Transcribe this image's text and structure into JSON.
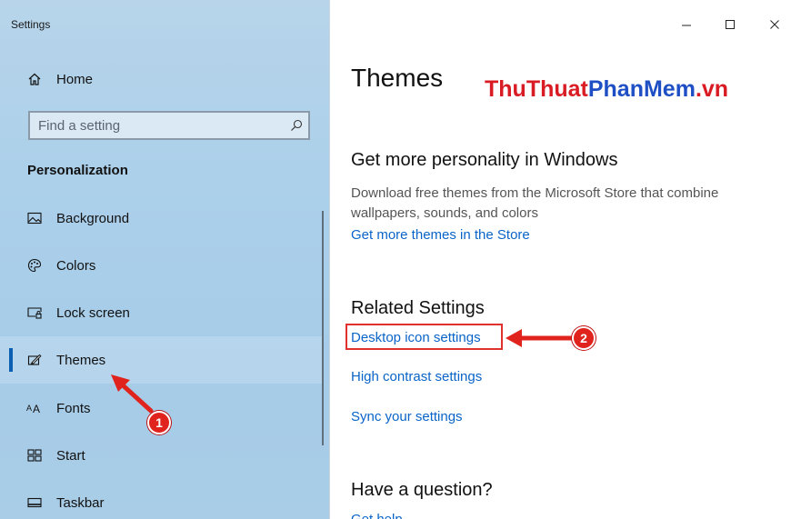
{
  "window": {
    "title": "Settings",
    "controls": {
      "minimize": "–",
      "maximize": "☐",
      "close": "✕"
    }
  },
  "sidebar": {
    "home_label": "Home",
    "search": {
      "placeholder": "Find a setting"
    },
    "section_header": "Personalization",
    "items": [
      {
        "label": "Background",
        "icon": "image-icon"
      },
      {
        "label": "Colors",
        "icon": "palette-icon"
      },
      {
        "label": "Lock screen",
        "icon": "lock-screen-icon"
      },
      {
        "label": "Themes",
        "icon": "brush-icon",
        "selected": true
      },
      {
        "label": "Fonts",
        "icon": "fonts-icon"
      },
      {
        "label": "Start",
        "icon": "start-icon"
      },
      {
        "label": "Taskbar",
        "icon": "taskbar-icon"
      }
    ]
  },
  "main": {
    "title": "Themes",
    "watermark": {
      "part1": "ThuThuat",
      "part2": "PhanMem",
      "part3": ".vn"
    },
    "personality": {
      "heading": "Get more personality in Windows",
      "description": "Download free themes from the Microsoft Store that combine wallpapers, sounds, and colors",
      "link": "Get more themes in the Store"
    },
    "related": {
      "heading": "Related Settings",
      "links": [
        "Desktop icon settings",
        "High contrast settings",
        "Sync your settings"
      ]
    },
    "question": {
      "heading": "Have a question?",
      "link": "Get help"
    }
  },
  "annotations": {
    "badge1": "1",
    "badge2": "2",
    "color": "#e0241d"
  }
}
